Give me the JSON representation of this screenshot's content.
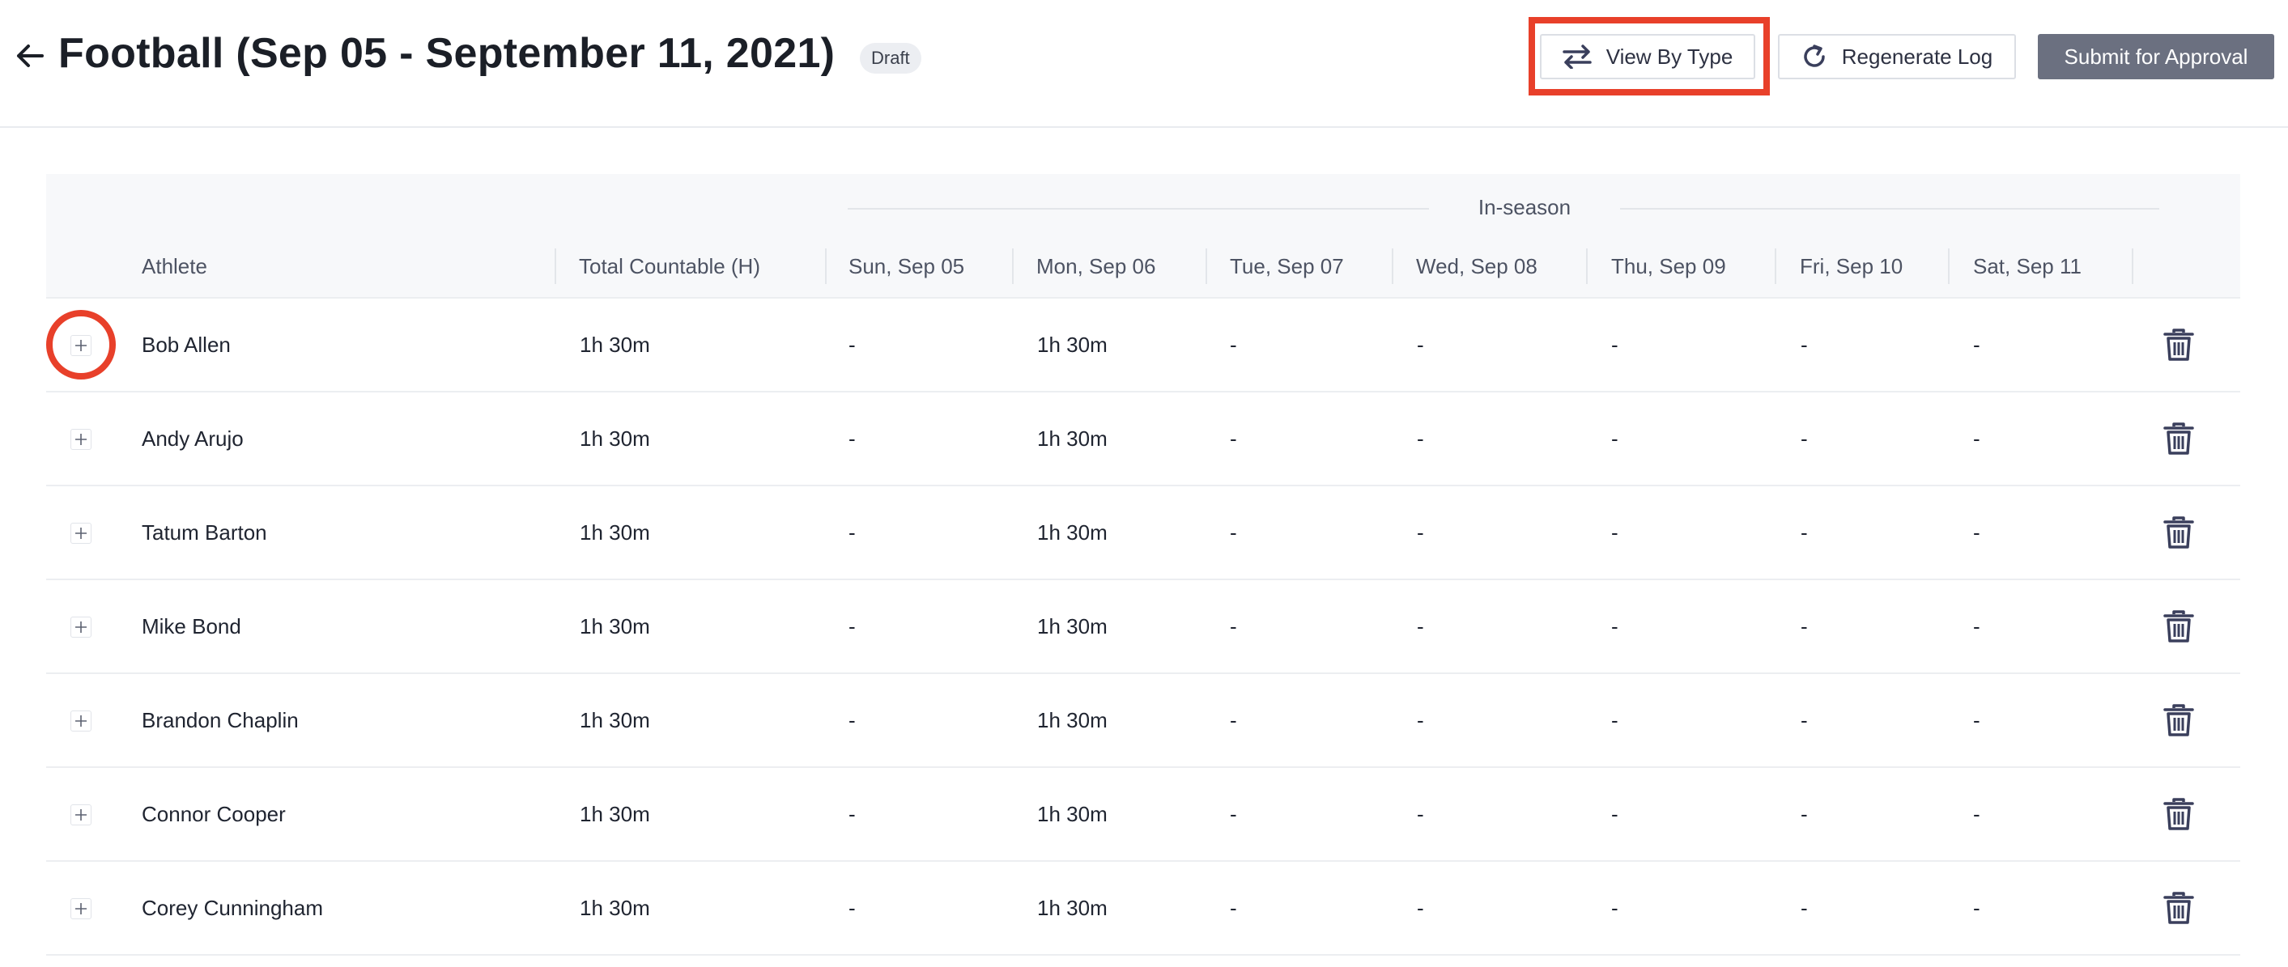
{
  "header": {
    "title": "Football (Sep 05 - September 11, 2021)",
    "status_badge": "Draft",
    "buttons": {
      "view_by_type": "View By Type",
      "regenerate_log": "Regenerate Log",
      "submit_for_approval": "Submit for Approval"
    }
  },
  "table": {
    "group_label": "In-season",
    "columns": [
      "Athlete",
      "Total Countable (H)",
      "Sun, Sep 05",
      "Mon, Sep 06",
      "Tue, Sep 07",
      "Wed, Sep 08",
      "Thu, Sep 09",
      "Fri, Sep 10",
      "Sat, Sep 11"
    ],
    "rows": [
      [
        "Bob Allen",
        "1h 30m",
        "-",
        "1h 30m",
        "-",
        "-",
        "-",
        "-",
        "-"
      ],
      [
        "Andy Arujo",
        "1h 30m",
        "-",
        "1h 30m",
        "-",
        "-",
        "-",
        "-",
        "-"
      ],
      [
        "Tatum Barton",
        "1h 30m",
        "-",
        "1h 30m",
        "-",
        "-",
        "-",
        "-",
        "-"
      ],
      [
        "Mike Bond",
        "1h 30m",
        "-",
        "1h 30m",
        "-",
        "-",
        "-",
        "-",
        "-"
      ],
      [
        "Brandon Chaplin",
        "1h 30m",
        "-",
        "1h 30m",
        "-",
        "-",
        "-",
        "-",
        "-"
      ],
      [
        "Connor Cooper",
        "1h 30m",
        "-",
        "1h 30m",
        "-",
        "-",
        "-",
        "-",
        "-"
      ],
      [
        "Corey Cunningham",
        "1h 30m",
        "-",
        "1h 30m",
        "-",
        "-",
        "-",
        "-",
        "-"
      ]
    ]
  },
  "colors": {
    "highlight": "#e8402a",
    "submit_button": "#6b7080",
    "header_bg": "#f7f8fa"
  },
  "icons": {
    "back": "arrow-left-icon",
    "swap": "swap-arrows-icon",
    "refresh": "refresh-icon",
    "expand": "plus-icon",
    "delete": "trash-icon"
  }
}
